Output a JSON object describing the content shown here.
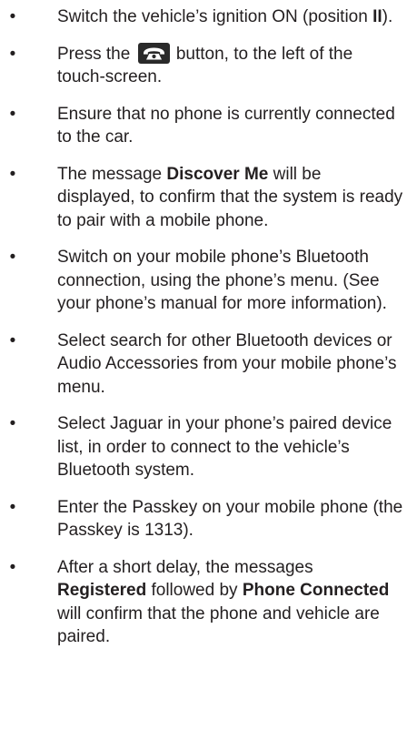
{
  "steps": [
    {
      "before": "Switch the vehicle’s ignition ON (position ",
      "bold": "II",
      "after": ")."
    },
    {
      "before": "Press the ",
      "icon": "phone-icon",
      "after": " button, to the left of the touch-screen."
    },
    {
      "before": "Ensure that no phone is currently connected to the car."
    },
    {
      "before": "The message ",
      "bold": "Discover Me",
      "after": " will be displayed, to confirm that the system is ready to pair with a mobile phone."
    },
    {
      "before": "Switch on your mobile phone’s Bluetooth connection, using the phone’s menu. (See your phone’s manual for more information)."
    },
    {
      "before": "Select search for other Bluetooth devices or Audio Accessories from your mobile phone’s menu."
    },
    {
      "before": "Select Jaguar in your phone’s paired device list, in order to connect to the vehicle’s Bluetooth system."
    },
    {
      "before": "Enter the Passkey on your mobile phone (the Passkey is 1313)."
    },
    {
      "before": "After a short delay, the messages ",
      "bold": "Registered",
      "middle": " followed by ",
      "bold2": "Phone Connected",
      "after": " will confirm that the phone and vehicle are paired."
    }
  ],
  "bullet_char": "•",
  "colors": {
    "text": "#231f20",
    "icon_bg": "#2a2a2a",
    "icon_fg": "#ffffff"
  }
}
